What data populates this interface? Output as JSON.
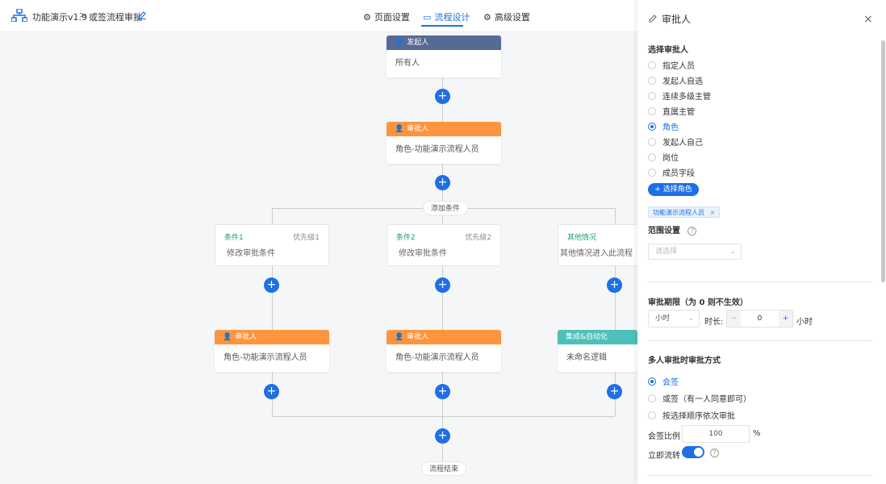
{
  "header": {
    "app_title": "功能演示v1.9",
    "separator": ">",
    "flow_name": "或签流程审批",
    "tabs": [
      {
        "label": "页面设置",
        "icon": "gear-icon",
        "active": false
      },
      {
        "label": "流程设计",
        "icon": "monitor-icon",
        "active": true
      },
      {
        "label": "高级设置",
        "icon": "gear-icon",
        "active": false
      }
    ]
  },
  "canvas": {
    "start_node": {
      "header": "发起人",
      "body": "所有人",
      "color": "#576a95"
    },
    "approver_node": {
      "header": "审批人",
      "body": "角色-功能演示流程人员",
      "color": "#ff943e"
    },
    "add_condition": "添加条件",
    "conditions": [
      {
        "title": "条件1",
        "priority": "优先级1",
        "desc": "修改审批条件"
      },
      {
        "title": "条件2",
        "priority": "优先级2",
        "desc": "修改审批条件"
      },
      {
        "title": "其他情况",
        "priority": "",
        "desc": "其他情况进入此流程"
      }
    ],
    "branch_nodes": [
      {
        "header": "审批人",
        "body": "角色-功能演示流程人员",
        "color": "#ff943e"
      },
      {
        "header": "审批人",
        "body": "角色-功能演示流程人员",
        "color": "#ff943e"
      },
      {
        "header": "集成&自动化",
        "body": "未命名逻辑",
        "color": "#4fc0b9"
      }
    ],
    "plus_symbol": "+",
    "end_label": "流程结束"
  },
  "panel": {
    "title": "审批人",
    "close": "×",
    "select_title": "选择审批人",
    "approver_options": [
      {
        "label": "指定人员",
        "checked": false
      },
      {
        "label": "发起人自选",
        "checked": false
      },
      {
        "label": "连续多级主管",
        "checked": false
      },
      {
        "label": "直属主管",
        "checked": false
      },
      {
        "label": "角色",
        "checked": true
      },
      {
        "label": "发起人自己",
        "checked": false
      },
      {
        "label": "岗位",
        "checked": false
      },
      {
        "label": "成员字段",
        "checked": false
      }
    ],
    "select_role_button": "+ 选择角色",
    "role_tag": "功能演示流程人员",
    "tag_close": "×",
    "scope_title": "范围设置",
    "help_glyph": "?",
    "scope_placeholder": "请选择",
    "deadline_title": "审批期限（为 0 则不生效）",
    "unit_value": "小时",
    "duration_label": "时长:",
    "stepper_minus": "−",
    "stepper_value": "0",
    "stepper_plus": "+",
    "duration_unit": "小时",
    "multi_title": "多人审批时审批方式",
    "multi_options": [
      {
        "label": "会签",
        "checked": true
      },
      {
        "label": "或签（有一人同意即可）",
        "checked": false
      },
      {
        "label": "按选择顺序依次审批",
        "checked": false
      }
    ],
    "ratio_label": "会签比例",
    "ratio_value": "100",
    "ratio_unit": "%",
    "instant_label": "立即流转",
    "accent": "#1f6fe5"
  }
}
